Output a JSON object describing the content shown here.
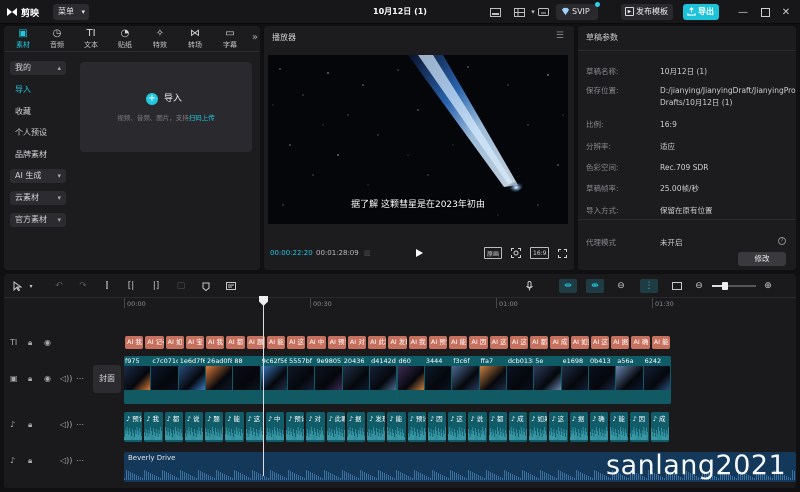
{
  "app": {
    "name": "剪映"
  },
  "titlebar": {
    "menu_label": "菜单",
    "project_title": "10月12日 (1)",
    "svip_label": "SVIP",
    "publish_label": "发布模板",
    "export_label": "导出"
  },
  "media": {
    "tabs": [
      {
        "label": "素材",
        "icon": "media-icon"
      },
      {
        "label": "音频",
        "icon": "audio-icon"
      },
      {
        "label": "文本",
        "icon": "text-icon"
      },
      {
        "label": "贴纸",
        "icon": "sticker-icon"
      },
      {
        "label": "特效",
        "icon": "effects-icon"
      },
      {
        "label": "转场",
        "icon": "transition-icon"
      },
      {
        "label": "字幕",
        "icon": "subtitle-icon"
      }
    ],
    "side_items": [
      "我的",
      "导入",
      "收藏",
      "个人预设",
      "品牌素材",
      "AI 生成",
      "云素材",
      "官方素材"
    ],
    "import_label": "导入",
    "import_hint": "视频、音频、图片，支持",
    "import_hint_link": "扫码上传"
  },
  "player": {
    "title": "播放器",
    "subtitle": "据了解 这颗彗星是在2023年初由",
    "current_time": "00:00:22:20",
    "total_time": "00:01:28:09",
    "quality_label": "原画",
    "ratio_label": "16:9"
  },
  "draft": {
    "title": "草稿参数",
    "rows": [
      {
        "key": "草稿名称:",
        "value": "10月12日 (1)"
      },
      {
        "key": "保存位置:",
        "value": "D:/jianying/JianyingDraft/JianyingPro Drafts/10月12日 (1)"
      },
      {
        "key": "比例:",
        "value": "16:9"
      },
      {
        "key": "分辨率:",
        "value": "适应"
      },
      {
        "key": "色彩空间:",
        "value": "Rec.709 SDR"
      },
      {
        "key": "草稿帧率:",
        "value": "25.00帧/秒"
      },
      {
        "key": "导入方式:",
        "value": "保留在原有位置"
      },
      {
        "key": "代理模式",
        "value": "未开启"
      }
    ],
    "edit_label": "修改"
  },
  "timeline": {
    "ruler": [
      "00:00",
      "00:30",
      "01:00",
      "01:30"
    ],
    "cover_label": "封面",
    "text_clips": [
      "AI 我",
      "AI 记者在",
      "AI 如",
      "AI 宝",
      "AI 我",
      "AI 都",
      "AI 题",
      "AI 能",
      "AI 这",
      "AI 中",
      "AI 预计",
      "AI 对",
      "AI 此颗彗星",
      "AI 发现",
      "AI 我",
      "AI 预计",
      "AI 能",
      "AI 因",
      "AI 这",
      "AI 这",
      "AI 都",
      "AI 成",
      "AI 如果",
      "AI 这",
      "AI 据",
      "AI 确",
      "AI 能"
    ],
    "video_clips": [
      "f975",
      "c7c071c",
      "1e6d7f64",
      "26ad0f8f1a",
      "88",
      "9c62f56b7b",
      "5557bf",
      "9e9805738253",
      "20436",
      "d4142d0f3",
      "d60",
      "3444",
      "f3c6f",
      "ffa7",
      "dcb0138",
      "5e",
      "e1698",
      "0b413",
      "a56a",
      "6242"
    ],
    "audio_clips": [
      "预计",
      "我",
      "都",
      "说",
      "题",
      "能",
      "这",
      "中",
      "预计",
      "对",
      "此颗彗星",
      "据",
      "发现",
      "能",
      "预计",
      "因",
      "这",
      "说",
      "都",
      "成",
      "如果",
      "这",
      "据",
      "确",
      "能",
      "因",
      "成"
    ],
    "music_label": "Beverly Drive"
  },
  "watermark": "sanlang2021",
  "colors": {
    "accent": "#21c8df",
    "text_clip": "#c8705e",
    "video_track": "#0f5c66",
    "music_track": "#13385a"
  }
}
